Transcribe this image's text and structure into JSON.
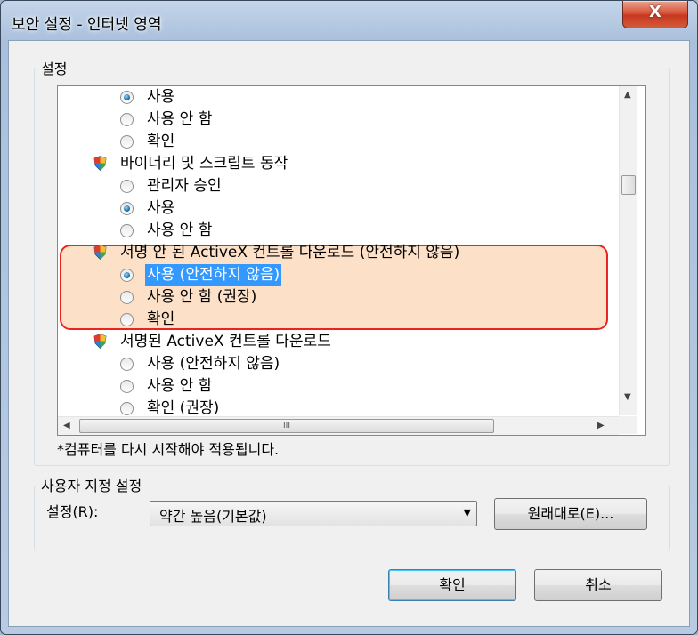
{
  "window": {
    "title": "보안 설정 - 인터넷 영역",
    "close_glyph": "X"
  },
  "settings_group": {
    "label": "설정",
    "items": [
      {
        "kind": "radio",
        "text": "사용",
        "checked": true
      },
      {
        "kind": "radio",
        "text": "사용 안 함",
        "checked": false
      },
      {
        "kind": "radio",
        "text": "확인",
        "checked": false
      },
      {
        "kind": "category",
        "text": "바이너리 및 스크립트 동작"
      },
      {
        "kind": "radio",
        "text": "관리자 승인",
        "checked": false
      },
      {
        "kind": "radio",
        "text": "사용",
        "checked": true
      },
      {
        "kind": "radio",
        "text": "사용 안 함",
        "checked": false
      },
      {
        "kind": "category",
        "text": "서명 안 된 ActiveX 컨트롤 다운로드 (안전하지 않음)"
      },
      {
        "kind": "radio",
        "text": "사용 (안전하지 않음)",
        "checked": true,
        "selected": true
      },
      {
        "kind": "radio",
        "text": "사용 안 함 (권장)",
        "checked": false
      },
      {
        "kind": "radio",
        "text": "확인",
        "checked": false
      },
      {
        "kind": "category",
        "text": "서명된 ActiveX 컨트롤 다운로드"
      },
      {
        "kind": "radio",
        "text": "사용 (안전하지 않음)",
        "checked": false
      },
      {
        "kind": "radio",
        "text": "사용 안 함",
        "checked": false
      },
      {
        "kind": "radio",
        "text": "확인 (권장)",
        "checked": false
      }
    ],
    "restart_note": "*컴퓨터를 다시 시작해야 적용됩니다.",
    "hscroll_grip": "III"
  },
  "custom_group": {
    "label": "사용자 지정 설정",
    "setting_label": "설정(R):",
    "selected_level": "약간 높음(기본값)",
    "reset_button": "원래대로(E)..."
  },
  "buttons": {
    "ok": "확인",
    "cancel": "취소"
  },
  "colors": {
    "highlight_border": "#e8261f",
    "highlight_fill": "#fde0c8",
    "selection": "#3399ff"
  }
}
